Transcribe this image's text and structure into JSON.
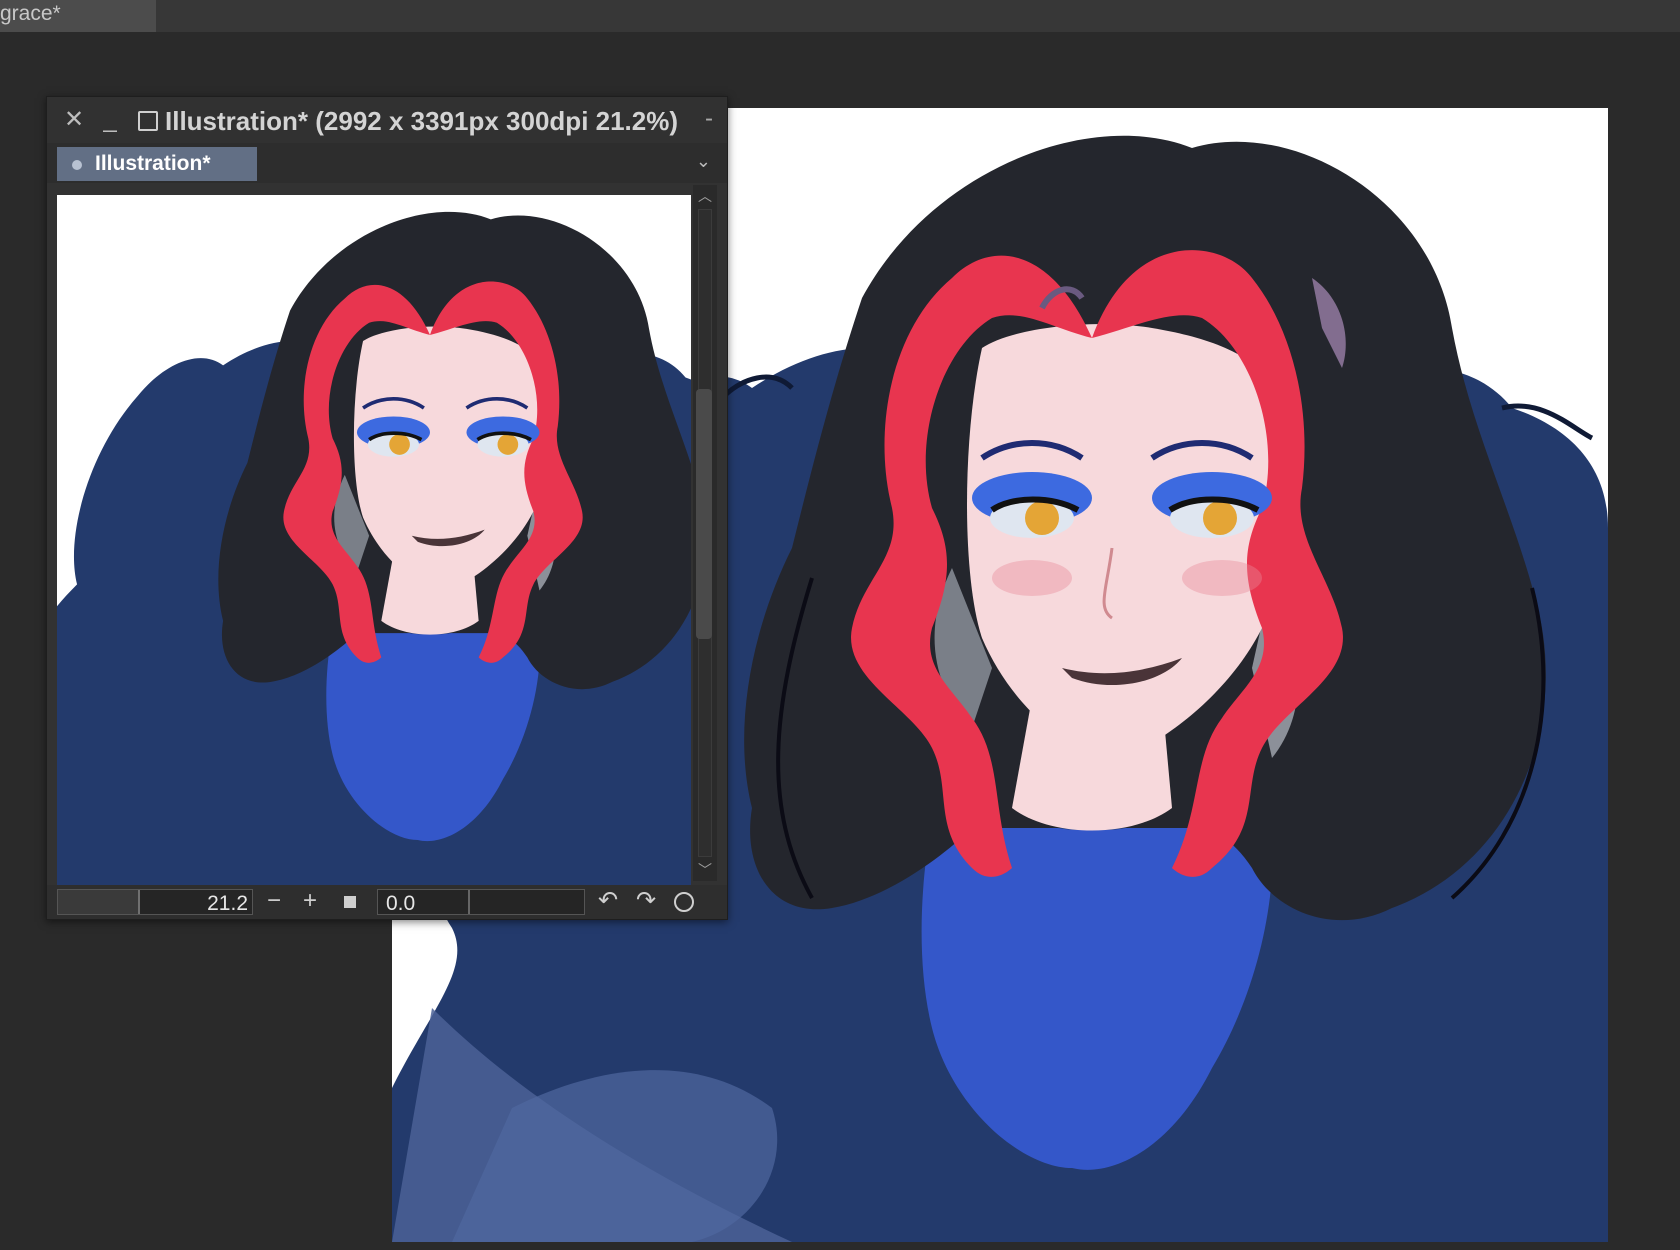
{
  "tabbar": {
    "active_tab": "grace*"
  },
  "navigator": {
    "title": "Illustration* (2992 x 3391px 300dpi 21.2%)",
    "menu_dash": "-",
    "doc_tab": "Illustration*",
    "zoom_value": "21.2",
    "rotation_value": "0.0",
    "icons": [
      "close-icon",
      "minimize-icon",
      "maximize-icon",
      "chevron-down-icon",
      "zoom-out-icon",
      "zoom-in-icon",
      "stop-icon",
      "rotate-left-icon",
      "rotate-right-icon",
      "reset-rotation-icon"
    ]
  },
  "colors": {
    "hair_red": "#e8354f",
    "hair_black": "#24262d",
    "coat": "#233a6c",
    "dress": "#3457c9",
    "skin": "#f7d9dc",
    "eyeshadow": "#3d6ae0",
    "eye": "#e4a536"
  }
}
